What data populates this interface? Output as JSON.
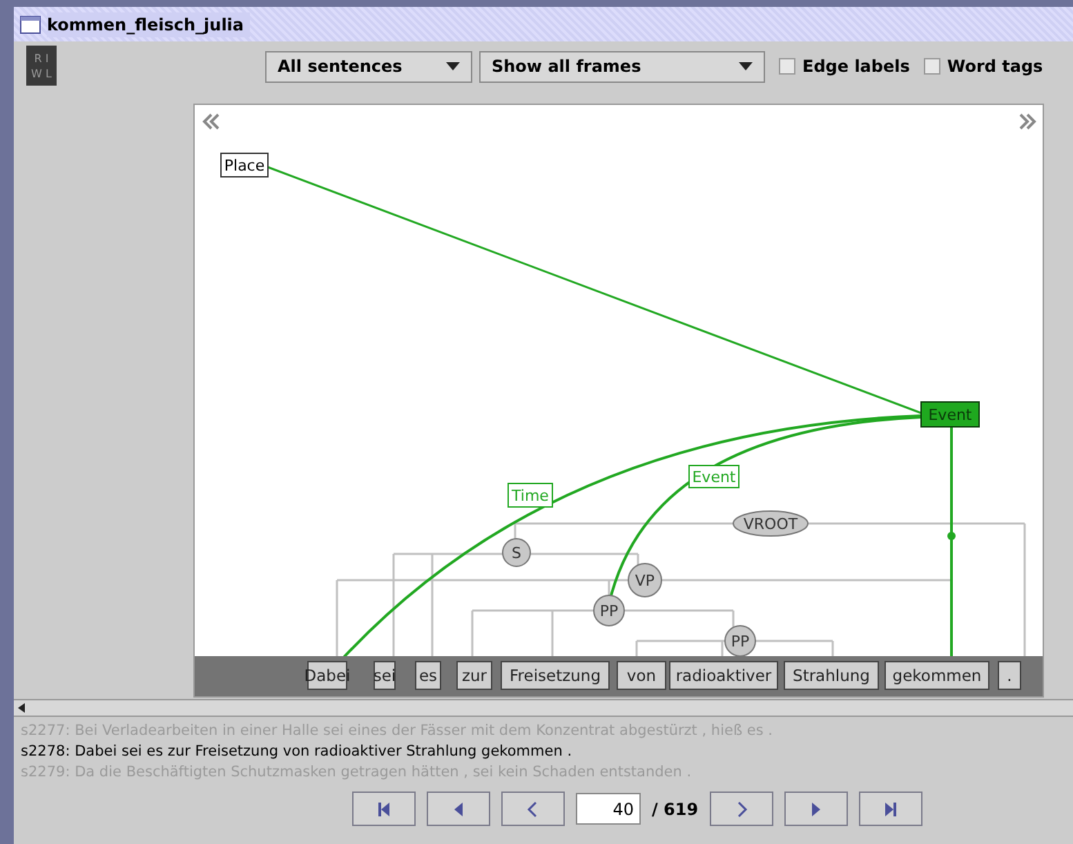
{
  "window": {
    "title": "kommen_fleisch_julia"
  },
  "toolbar": {
    "badge": [
      "R I",
      "W L"
    ],
    "sentence_filter": "All sentences",
    "frame_filter": "Show all frames",
    "checkboxes": [
      {
        "label": "Edge labels",
        "checked": false
      },
      {
        "label": "Word tags",
        "checked": false
      }
    ]
  },
  "graph": {
    "frame_nodes": [
      {
        "label": "Place",
        "kind": "element"
      },
      {
        "label": "Event",
        "kind": "target"
      },
      {
        "label": "Time",
        "kind": "role"
      },
      {
        "label": "Event",
        "kind": "role"
      }
    ],
    "syntax_nodes": [
      {
        "label": "VROOT",
        "kind": "ellipse"
      },
      {
        "label": "S",
        "kind": "circle"
      },
      {
        "label": "VP",
        "kind": "circle"
      },
      {
        "label": "PP",
        "kind": "circle"
      },
      {
        "label": "PP",
        "kind": "circle"
      }
    ],
    "words": [
      "Dabei",
      "sei",
      "es",
      "zur",
      "Freisetzung",
      "von",
      "radioaktiver",
      "Strahlung",
      "gekommen",
      "."
    ]
  },
  "sentences": [
    {
      "id": "s2277:",
      "text": "Bei Verladearbeiten in einer Halle sei eines der Fässer mit dem Konzentrat abgestürzt , hieß es .",
      "selected": false
    },
    {
      "id": "s2278:",
      "text": "Dabei sei es zur Freisetzung von radioaktiver Strahlung gekommen .",
      "selected": true
    },
    {
      "id": "s2279:",
      "text": "Da die Beschäftigten Schutzmasken getragen hätten , sei kein Schaden entstanden .",
      "selected": false
    }
  ],
  "navigation": {
    "page": "40",
    "total": "/ 619"
  }
}
